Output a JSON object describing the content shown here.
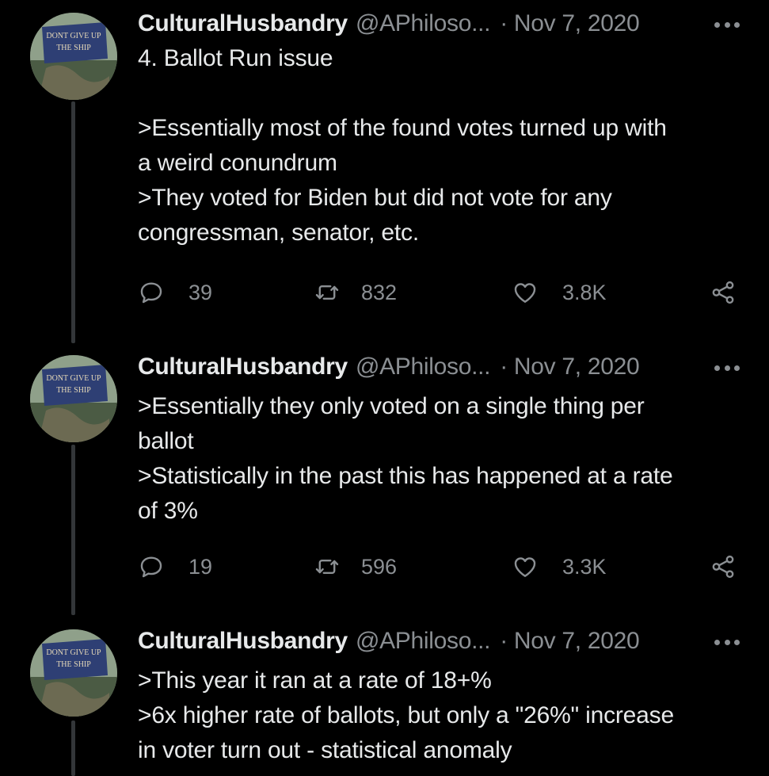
{
  "tweets": [
    {
      "avatar_text": [
        "DONT GIVE UP",
        "THE SHIP"
      ],
      "name": "CulturalHusbandry",
      "handle": "@APhiloso...",
      "separator": "·",
      "date": "Nov 7, 2020",
      "lines": [
        "4. Ballot Run issue",
        "",
        ">Essentially most of the found votes turned up with",
        "a weird conundrum",
        ">They voted for Biden but did not vote for any",
        "congressman, senator, etc."
      ],
      "replies": "39",
      "retweets": "832",
      "likes": "3.8K"
    },
    {
      "avatar_text": [
        "DONT GIVE UP",
        "THE SHIP"
      ],
      "name": "CulturalHusbandry",
      "handle": "@APhiloso...",
      "separator": "·",
      "date": "Nov 7, 2020",
      "lines": [
        ">Essentially they only voted on a single thing per",
        "ballot",
        ">Statistically in the past this has happened at a rate",
        "of 3%"
      ],
      "replies": "19",
      "retweets": "596",
      "likes": "3.3K"
    },
    {
      "avatar_text": [
        "DONT GIVE UP",
        "THE SHIP"
      ],
      "name": "CulturalHusbandry",
      "handle": "@APhiloso...",
      "separator": "·",
      "date": "Nov 7, 2020",
      "lines": [
        ">This year it ran at a rate of 18+%",
        ">6x higher rate of ballots, but only a \"26%\" increase",
        "in voter turn out - statistical anomaly"
      ]
    }
  ],
  "colors": {
    "background": "#000000",
    "text": "#e7e9ea",
    "muted": "#8b8f93",
    "thread_line": "#333639"
  },
  "icons": [
    "reply-icon",
    "retweet-icon",
    "like-icon",
    "share-icon",
    "more-icon"
  ]
}
